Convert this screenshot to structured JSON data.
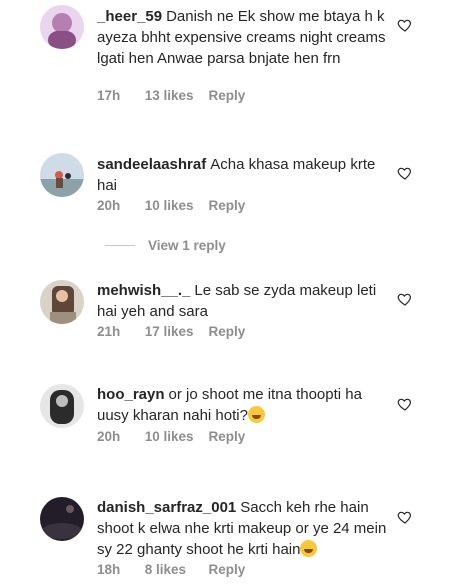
{
  "comments": [
    {
      "username": "_heer_59",
      "text": "Danish ne Ek show me btaya h k ayeza bhht expensive creams night creams lgati hen Anwae parsa bnjate hen frn",
      "time": "17h",
      "likes": "13 likes",
      "reply": "Reply",
      "avatar_color": "#b77fb1"
    },
    {
      "username": "sandeelaashraf",
      "text": "Acha khasa makeup krte hai",
      "time": "20h",
      "likes": "10 likes",
      "reply": "Reply",
      "avatar_color": "#9db3c9"
    },
    {
      "username": "mehwish__._",
      "text": "Le sab se zyda makeup leti hai yeh and sara",
      "time": "21h",
      "likes": "17 likes",
      "reply": "Reply",
      "avatar_color": "#8c7a6a"
    },
    {
      "username": "hoo_rayn",
      "text": "or jo shoot me itna thoopti ha uusy kharan nahi hoti?",
      "time": "20h",
      "likes": "10 likes",
      "reply": "Reply",
      "avatar_color": "#444444",
      "emoji": "joy-emoji"
    },
    {
      "username": "danish_sarfraz_001",
      "text": "Sacch keh rhe hain shoot k elwa nhe krti makeup or ye 24 mein sy 22 ghanty shoot he krti hain",
      "time": "18h",
      "likes": "8 likes",
      "reply": "Reply",
      "avatar_color": "#2a2330",
      "emoji": "joy-emoji"
    }
  ],
  "view_replies": "View 1 reply",
  "colors": {
    "text": "#262626",
    "meta": "#8e8e8e"
  }
}
